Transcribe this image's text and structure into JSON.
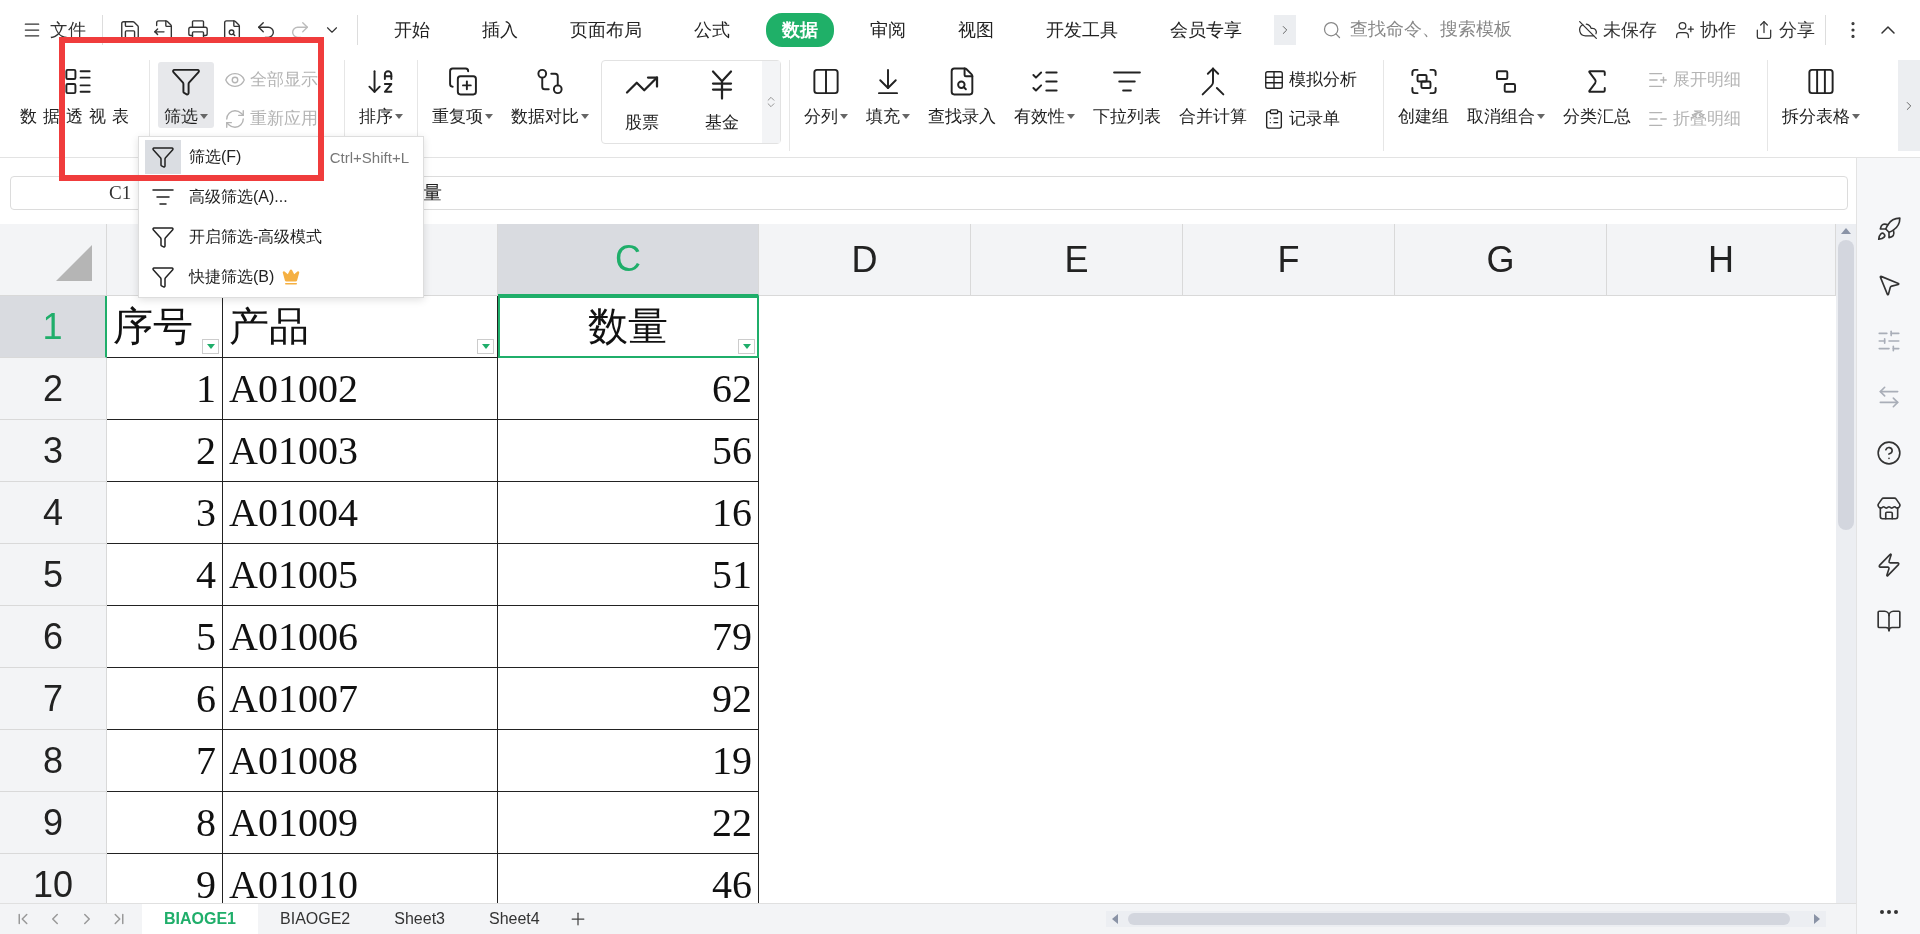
{
  "menu_bar": {
    "file_label": "文件",
    "tabs": [
      {
        "label": "开始",
        "selected": false
      },
      {
        "label": "插入",
        "selected": false
      },
      {
        "label": "页面布局",
        "selected": false
      },
      {
        "label": "公式",
        "selected": false
      },
      {
        "label": "数据",
        "selected": true
      },
      {
        "label": "审阅",
        "selected": false
      },
      {
        "label": "视图",
        "selected": false
      },
      {
        "label": "开发工具",
        "selected": false
      },
      {
        "label": "会员专享",
        "selected": false
      }
    ],
    "search": {
      "placeholder": "查找命令、搜索模板"
    },
    "actions": [
      "未保存",
      "协作",
      "分享"
    ]
  },
  "ribbon": {
    "groups": [
      {
        "items": [
          {
            "kind": "large",
            "label": "数据透视表",
            "dropdown": false,
            "pressed": false
          }
        ]
      },
      {
        "items": [
          {
            "kind": "large",
            "label": "筛选",
            "dropdown": true,
            "pressed": true
          },
          {
            "kind": "pair",
            "entries": [
              {
                "label": "全部显示",
                "disabled": true
              },
              {
                "label": "重新应用",
                "disabled": true
              }
            ]
          }
        ]
      },
      {
        "items": [
          {
            "kind": "large",
            "label": "排序",
            "dropdown": true,
            "pressed": false
          }
        ]
      },
      {
        "items": [
          {
            "kind": "large",
            "label": "重复项",
            "dropdown": true,
            "pressed": false
          },
          {
            "kind": "large",
            "label": "数据对比",
            "dropdown": true,
            "pressed": false
          },
          {
            "kind": "gallery",
            "entries": [
              {
                "label": "股票"
              },
              {
                "label": "基金"
              }
            ]
          }
        ]
      },
      {
        "items": [
          {
            "kind": "large",
            "label": "分列",
            "dropdown": true,
            "pressed": false
          },
          {
            "kind": "large",
            "label": "填充",
            "dropdown": true,
            "pressed": false
          },
          {
            "kind": "large",
            "label": "查找录入",
            "dropdown": false,
            "pressed": false
          },
          {
            "kind": "large",
            "label": "有效性",
            "dropdown": true,
            "pressed": false
          },
          {
            "kind": "large",
            "label": "下拉列表",
            "dropdown": false,
            "pressed": false
          },
          {
            "kind": "large",
            "label": "合并计算",
            "dropdown": false,
            "pressed": false
          },
          {
            "kind": "pair",
            "entries": [
              {
                "label": "模拟分析",
                "disabled": false
              },
              {
                "label": "记录单",
                "disabled": false
              }
            ]
          }
        ]
      },
      {
        "items": [
          {
            "kind": "large",
            "label": "创建组",
            "dropdown": false,
            "pressed": false
          },
          {
            "kind": "large",
            "label": "取消组合",
            "dropdown": true,
            "pressed": false
          },
          {
            "kind": "large",
            "label": "分类汇总",
            "dropdown": false,
            "pressed": false
          },
          {
            "kind": "pair",
            "entries": [
              {
                "label": "展开明细",
                "disabled": true
              },
              {
                "label": "折叠明细",
                "disabled": true
              }
            ]
          }
        ]
      },
      {
        "items": [
          {
            "kind": "large",
            "label": "拆分表格",
            "dropdown": true,
            "pressed": false
          }
        ]
      }
    ]
  },
  "filter_menu": {
    "items": [
      {
        "label": "筛选(F)",
        "shortcut": "Ctrl+Shift+L",
        "selected": true,
        "premium": false
      },
      {
        "label": "高级筛选(A)...",
        "selected": false,
        "premium": false
      },
      {
        "label": "开启筛选-高级模式",
        "selected": false,
        "premium": false
      },
      {
        "label": "快捷筛选(B)",
        "selected": false,
        "premium": true
      }
    ]
  },
  "formula_bar": {
    "cell_ref": "C1",
    "content": "量"
  },
  "sheet": {
    "columns": [
      {
        "selected": false
      },
      {
        "selected": false
      },
      {
        "label": "C",
        "selected": true
      },
      {
        "label": "D",
        "selected": false
      },
      {
        "label": "E",
        "selected": false
      },
      {
        "label": "F",
        "selected": false
      },
      {
        "label": "G",
        "selected": false
      },
      {
        "label": "H",
        "selected": false
      }
    ],
    "rows": [
      {
        "number": "1",
        "kind": "header",
        "selected": true,
        "cells": [
          "序号",
          "产品",
          "数量"
        ]
      },
      {
        "number": "2",
        "kind": "data",
        "selected": false,
        "cells": [
          "1",
          "A01002",
          "62"
        ]
      },
      {
        "number": "3",
        "kind": "data",
        "selected": false,
        "cells": [
          "2",
          "A01003",
          "56"
        ]
      },
      {
        "number": "4",
        "kind": "data",
        "selected": false,
        "cells": [
          "3",
          "A01004",
          "16"
        ]
      },
      {
        "number": "5",
        "kind": "data",
        "selected": false,
        "cells": [
          "4",
          "A01005",
          "51"
        ]
      },
      {
        "number": "6",
        "kind": "data",
        "selected": false,
        "cells": [
          "5",
          "A01006",
          "79"
        ]
      },
      {
        "number": "7",
        "kind": "data",
        "selected": false,
        "cells": [
          "6",
          "A01007",
          "92"
        ]
      },
      {
        "number": "8",
        "kind": "data",
        "selected": false,
        "cells": [
          "7",
          "A01008",
          "19"
        ]
      },
      {
        "number": "9",
        "kind": "data",
        "selected": false,
        "cells": [
          "8",
          "A01009",
          "22"
        ]
      },
      {
        "number": "10",
        "kind": "data",
        "selected": false,
        "cells": [
          "9",
          "A01010",
          "46"
        ]
      }
    ]
  },
  "sheet_tabs": [
    {
      "label": "BIAOGE1",
      "selected": true
    },
    {
      "label": "BIAOGE2",
      "selected": false
    },
    {
      "label": "Sheet3",
      "selected": false
    },
    {
      "label": "Sheet4",
      "selected": false
    }
  ]
}
